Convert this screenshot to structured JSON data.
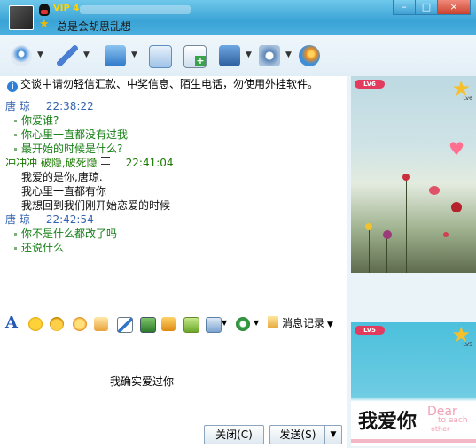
{
  "titlebar": {
    "vip_label": "VIP 4",
    "signature": "总是会胡思乱想",
    "controls": [
      "–",
      "□",
      "×"
    ]
  },
  "toolbar": {
    "tools": [
      {
        "name": "webcam-tool",
        "icon": "webcam-icon",
        "color": "#3b8ad8",
        "dropdown": true
      },
      {
        "name": "voice-tool",
        "icon": "microphone-icon",
        "color": "#4a7fd3",
        "dropdown": true
      },
      {
        "name": "send-file-tool",
        "icon": "folder-icon",
        "color": "#4b8fd8",
        "dropdown": true
      },
      {
        "name": "email-tool",
        "icon": "mail-icon",
        "color": "#5a9bd8",
        "dropdown": false
      },
      {
        "name": "create-group-tool",
        "icon": "add-chat-icon",
        "color": "#3aa24a",
        "dropdown": false
      },
      {
        "name": "remote-assist-tool",
        "icon": "remote-icon",
        "color": "#3f7cc9",
        "dropdown": true
      },
      {
        "name": "apps-tool",
        "icon": "apps-icon",
        "color": "#5d86b8",
        "dropdown": true
      },
      {
        "name": "qq-browser-tool",
        "icon": "browser-icon",
        "color": "#e88a22",
        "dropdown": false
      }
    ]
  },
  "notice": "交谈中请勿轻信汇款、中奖信息、陌生电话，勿使用外挂软件。",
  "history": [
    {
      "sender": "唐    琼",
      "time": "22:38:22",
      "side": "self",
      "lines": [
        "你爱谁?",
        "你心里一直都没有过我",
        "最开始的时候是什么?"
      ]
    },
    {
      "sender": "冲冲冲   破隐,破死隐",
      "time": "22:41:04",
      "side": "other",
      "lines": [
        "我爱的是你,唐琼.",
        "我心里一直都有你",
        "我想回到我们刚开始恋爱的时候"
      ]
    },
    {
      "sender": "唐    琼",
      "time": "22:42:54",
      "side": "self",
      "lines": [
        "你不是什么都改了吗",
        "还说什么"
      ]
    }
  ],
  "input_toolbar": {
    "font_label": "A",
    "message_record_label": "消息记录"
  },
  "input": {
    "text": "我确实爱过你"
  },
  "buttons": {
    "close_label": "关闭(C)",
    "send_label": "发送(S)",
    "send_dropdown": "▼"
  },
  "right_panel": {
    "top_level": "LV6",
    "bottom_level": "LV5",
    "bottom_love_text": "我爱你",
    "bottom_dear": "Dear",
    "bottom_to_each": "to each",
    "bottom_other": "other"
  }
}
